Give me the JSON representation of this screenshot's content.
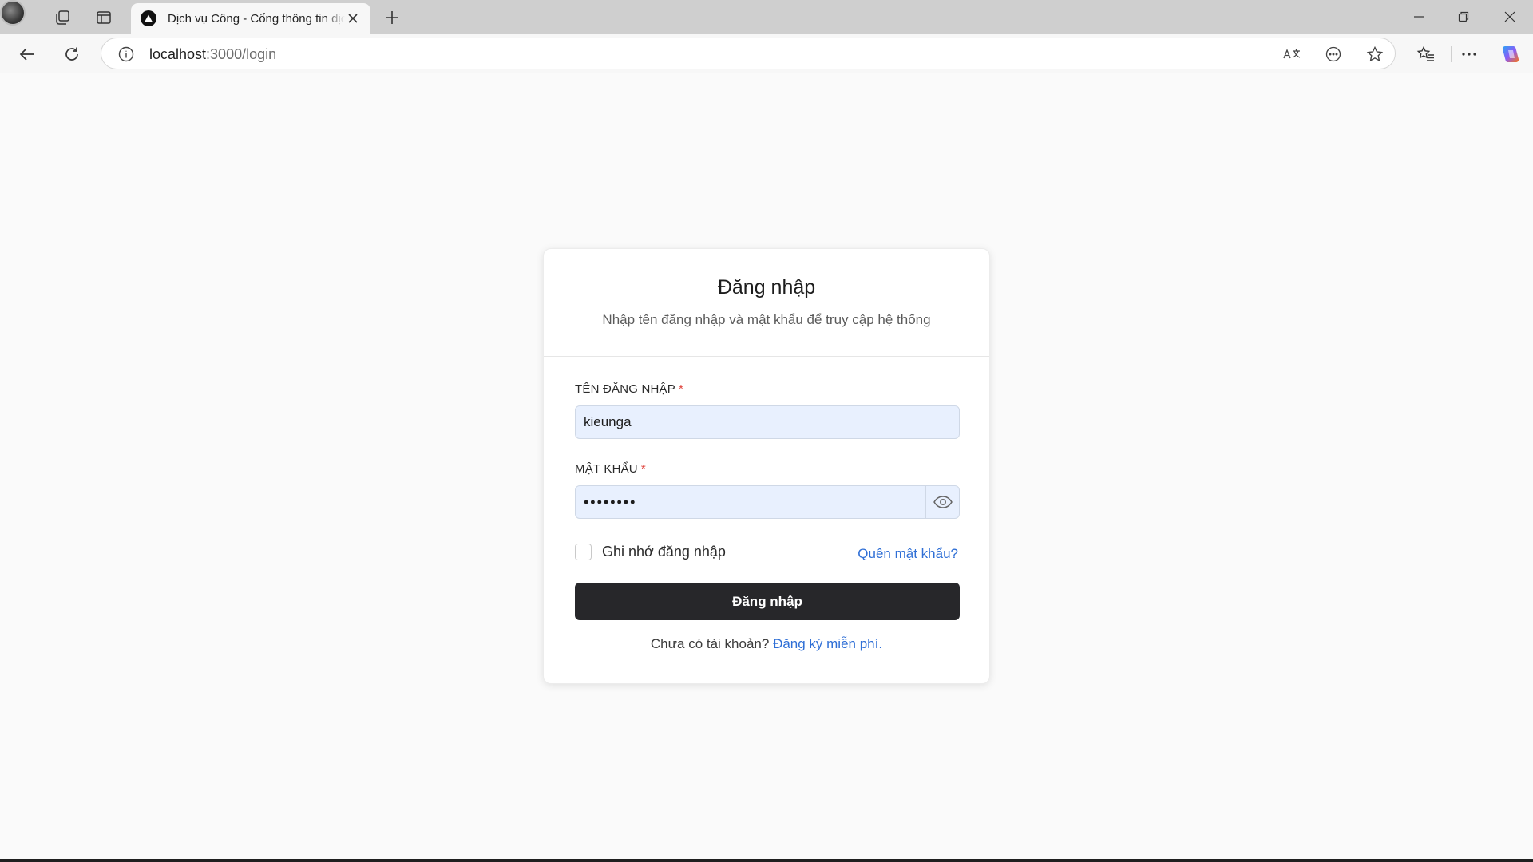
{
  "browser": {
    "tab_title": "Dịch vụ Công - Cổng thông tin dịch vụ",
    "url_host": "localhost",
    "url_path": ":3000/login",
    "icons": {
      "profile": "profile-avatar",
      "collections": "collections-icon",
      "tab_actions": "tab-actions-icon",
      "favicon": "triangle-logo-icon",
      "close_tab": "close-icon",
      "new_tab": "plus-icon",
      "back": "back-arrow-icon",
      "reload": "reload-icon",
      "info": "info-icon",
      "translate": "translate-icon",
      "more_tools": "more-circle-icon",
      "favorite": "star-icon",
      "favorites_list": "favorites-icon",
      "menu": "ellipsis-icon",
      "copilot": "copilot-icon"
    }
  },
  "login": {
    "title": "Đăng nhập",
    "subtitle": "Nhập tên đăng nhập và mật khẩu để truy cập hệ thống",
    "username_label": "TÊN ĐĂNG NHẬP",
    "username_value": "kieunga",
    "password_label": "MẬT KHẨU",
    "password_masked": "••••••••",
    "required_mark": "*",
    "remember_label": "Ghi nhớ đăng nhập",
    "forgot_link": "Quên mật khẩu?",
    "submit_label": "Đăng nhập",
    "signup_prompt": "Chưa có tài khoản?",
    "signup_link": "Đăng ký miễn phí."
  },
  "colors": {
    "accent_link": "#2f6fd6",
    "button_bg": "#27272a",
    "input_autofill_bg": "#e8f0fe",
    "required": "#e0463f"
  }
}
